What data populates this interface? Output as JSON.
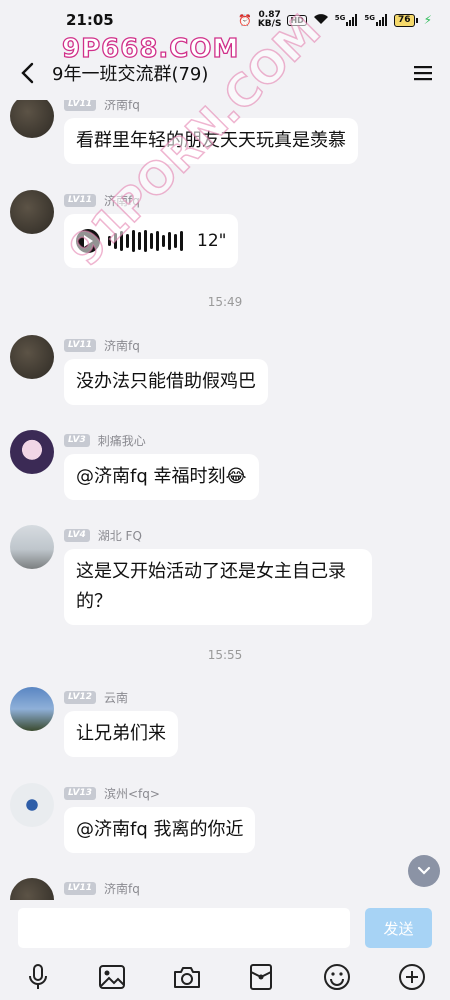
{
  "status_bar": {
    "time": "21:05",
    "net_speed_value": "0.87",
    "net_speed_unit": "KB/S",
    "hd": "HD",
    "signal_1": "5G",
    "signal_2": "5G",
    "battery": "76"
  },
  "watermarks": {
    "top": "9P668.COM",
    "diagonal": "91PORN.COM"
  },
  "header": {
    "title": "9年一班交流群(79)"
  },
  "messages": [
    {
      "level": "LV11",
      "nick": "济南fq",
      "text": "看群里年轻的朋友天天玩真是羡慕"
    },
    {
      "level": "LV11",
      "nick": "济南fq",
      "voice_duration": "12\""
    },
    {
      "timestamp": "15:49"
    },
    {
      "level": "LV11",
      "nick": "济南fq",
      "text": "没办法只能借助假鸡巴"
    },
    {
      "level": "LV3",
      "nick": "刺痛我心",
      "text": "@济南fq 幸福时刻😂"
    },
    {
      "level": "LV4",
      "nick": "湖北 FQ",
      "text_line1": "这是又开始活动了还是女主自己录",
      "text_line2": "的？"
    },
    {
      "timestamp": "15:55"
    },
    {
      "level": "LV12",
      "nick": "云南",
      "text": "让兄弟们来"
    },
    {
      "level": "LV13",
      "nick": "滨州<fq>",
      "text": "@济南fq 我离的你近"
    },
    {
      "level": "LV11",
      "nick": "济南fq"
    }
  ],
  "input": {
    "value": "",
    "send_label": "发送"
  },
  "colors": {
    "background": "#f2f2f5",
    "bubble": "#ffffff",
    "send_button": "#a7d3f5",
    "level_badge": "#c7cad2",
    "scroll_button": "#8b93a5"
  },
  "icons": {
    "toolbar": [
      "microphone-icon",
      "image-icon",
      "camera-icon",
      "red-packet-icon",
      "emoji-icon",
      "plus-icon"
    ]
  }
}
